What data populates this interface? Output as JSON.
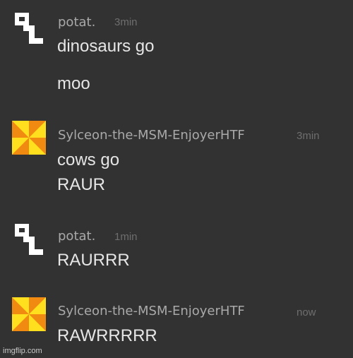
{
  "messages": [
    {
      "author": "potat.",
      "avatar": "potat-pixel-icon",
      "time": "3min",
      "lines": [
        "dinosaurs go",
        "moo"
      ]
    },
    {
      "author": "Sylceon-the-MSM-EnjoyerHTF",
      "avatar": "orange-pinwheel-icon",
      "time": "3min",
      "lines": [
        "cows go",
        "RAUR"
      ]
    },
    {
      "author": "potat.",
      "avatar": "potat-pixel-icon",
      "time": "1min",
      "lines": [
        "RAURRR"
      ]
    },
    {
      "author": "Sylceon-the-MSM-EnjoyerHTF",
      "avatar": "orange-pinwheel-icon",
      "time": "now",
      "lines": [
        "RAWRRRRR"
      ]
    }
  ],
  "colors": {
    "background": "#323232",
    "author": "#a9a9a9",
    "timestamp": "#6e6e6e",
    "message": "#e6e6e6",
    "pinwheel_orange": "#f08a10",
    "pinwheel_yellow": "#ffdf1e"
  },
  "watermark": "imgflip.com"
}
